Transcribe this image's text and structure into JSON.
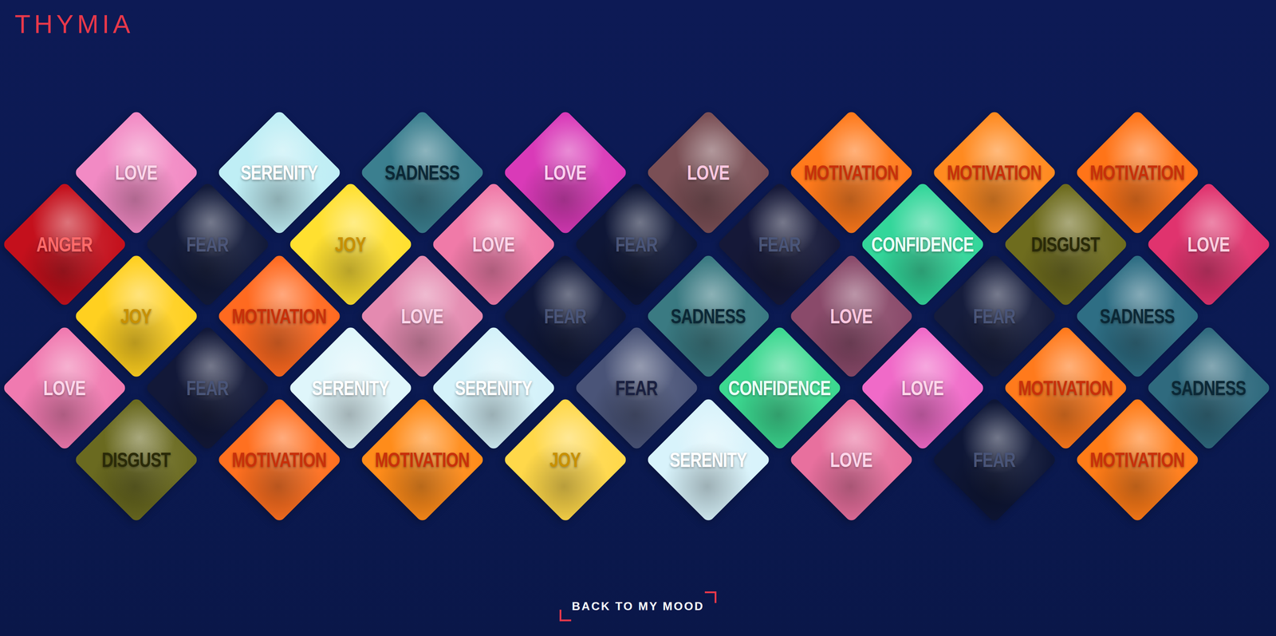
{
  "logo": "THYMIA",
  "rows": [
    {
      "tiles": [
        {
          "label": "LOVE",
          "color": "#f28ac4",
          "ink": "#ffd6ea"
        },
        {
          "label": "SERENITY",
          "color": "#bfeef5",
          "ink": "#ffffff"
        },
        {
          "label": "SADNESS",
          "color": "#3b7f8f",
          "ink": "#0b2836"
        },
        {
          "label": "LOVE",
          "color": "#d93ab8",
          "ink": "#ffd0f0"
        },
        {
          "label": "LOVE",
          "color": "#7a4f55",
          "ink": "#ffc8e0"
        },
        {
          "label": "MOTIVATION",
          "color": "#ff7a1c",
          "ink": "#c8300a"
        },
        {
          "label": "MOTIVATION",
          "color": "#ff8a20",
          "ink": "#c8300a"
        },
        {
          "label": "MOTIVATION",
          "color": "#ff7418",
          "ink": "#c8300a"
        }
      ]
    },
    {
      "tiles": [
        {
          "label": "ANGER",
          "color": "#c4101c",
          "ink": "#ff6a6a"
        },
        {
          "label": "FEAR",
          "color": "#121a3a",
          "ink": "#4c5678"
        },
        {
          "label": "JOY",
          "color": "#ffe030",
          "ink": "#c89000"
        },
        {
          "label": "LOVE",
          "color": "#f07aa8",
          "ink": "#ffd6ea"
        },
        {
          "label": "FEAR",
          "color": "#0e1636",
          "ink": "#4a5578"
        },
        {
          "label": "FEAR",
          "color": "#151838",
          "ink": "#4a5578"
        },
        {
          "label": "CONFIDENCE",
          "color": "#33d69a",
          "ink": "#eafff6"
        },
        {
          "label": "DISGUST",
          "color": "#6e6c1e",
          "ink": "#2a2a08"
        },
        {
          "label": "LOVE",
          "color": "#e0336e",
          "ink": "#ffd0e0"
        }
      ]
    },
    {
      "tiles": [
        {
          "label": "JOY",
          "color": "#ffd020",
          "ink": "#c89000"
        },
        {
          "label": "MOTIVATION",
          "color": "#ff6a20",
          "ink": "#c8300a"
        },
        {
          "label": "LOVE",
          "color": "#e48ab0",
          "ink": "#ffd6ea"
        },
        {
          "label": "FEAR",
          "color": "#0f1738",
          "ink": "#4a5578"
        },
        {
          "label": "SADNESS",
          "color": "#3a7a82",
          "ink": "#0b2836"
        },
        {
          "label": "LOVE",
          "color": "#8a4a6a",
          "ink": "#ffc8e0"
        },
        {
          "label": "FEAR",
          "color": "#151c3c",
          "ink": "#4a5578"
        },
        {
          "label": "SADNESS",
          "color": "#2e6e84",
          "ink": "#0b2836"
        }
      ]
    },
    {
      "tiles": [
        {
          "label": "LOVE",
          "color": "#f07ab0",
          "ink": "#ffd6ea"
        },
        {
          "label": "FEAR",
          "color": "#121838",
          "ink": "#4a5578"
        },
        {
          "label": "SERENITY",
          "color": "#dff6fb",
          "ink": "#ffffff"
        },
        {
          "label": "SERENITY",
          "color": "#d4f2fa",
          "ink": "#ffffff"
        },
        {
          "label": "FEAR",
          "color": "#4a5478",
          "ink": "#1a2040"
        },
        {
          "label": "CONFIDENCE",
          "color": "#3cd890",
          "ink": "#eafff6"
        },
        {
          "label": "LOVE",
          "color": "#f06ac8",
          "ink": "#ffd6ea"
        },
        {
          "label": "MOTIVATION",
          "color": "#ff7a1c",
          "ink": "#c8300a"
        },
        {
          "label": "SADNESS",
          "color": "#2f6a7e",
          "ink": "#0b2836"
        }
      ]
    },
    {
      "tiles": [
        {
          "label": "DISGUST",
          "color": "#6a6a20",
          "ink": "#2a2a08"
        },
        {
          "label": "MOTIVATION",
          "color": "#ff7020",
          "ink": "#c8300a"
        },
        {
          "label": "MOTIVATION",
          "color": "#ff8c1a",
          "ink": "#c8300a"
        },
        {
          "label": "JOY",
          "color": "#ffd84a",
          "ink": "#c89000"
        },
        {
          "label": "SERENITY",
          "color": "#d8f3fb",
          "ink": "#ffffff"
        },
        {
          "label": "LOVE",
          "color": "#e8709e",
          "ink": "#ffd6ea"
        },
        {
          "label": "FEAR",
          "color": "#0e1636",
          "ink": "#4a5578"
        },
        {
          "label": "MOTIVATION",
          "color": "#ff7c18",
          "ink": "#c8300a"
        }
      ]
    }
  ],
  "back_button": "BACK TO MY MOOD"
}
